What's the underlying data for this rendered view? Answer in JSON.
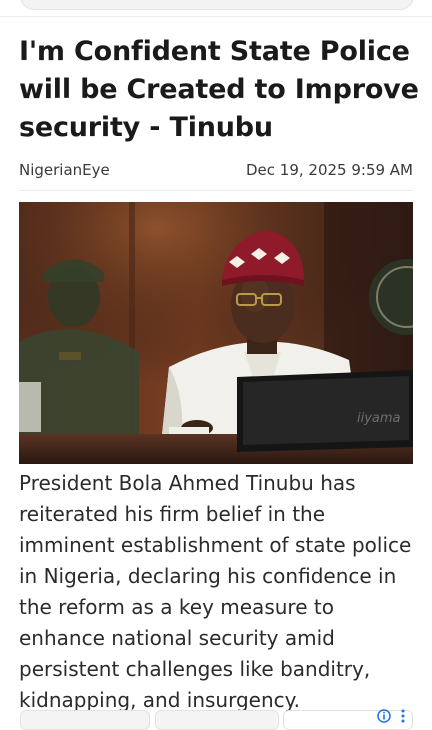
{
  "article": {
    "title": "I'm Confident State Police will be Created to Improve security - Tinubu",
    "source": "NigerianEye",
    "date": "Dec 19, 2025 9:59 AM",
    "image_alt": "President Bola Ahmed Tinubu seated at a meeting desk",
    "monitor_brand": "iiyama",
    "body": "President Bola Ahmed Tinubu has reiterated his firm belief in the imminent establishment of state police in Nigeria, declaring his confidence in the reform as a key measure to enhance national security amid persistent challenges like banditry, kidnapping, and insurgency."
  },
  "ad": {
    "info_icon": "info-icon",
    "menu_icon": "more-vert-icon"
  },
  "colors": {
    "accent_blue": "#1a73e8",
    "cap_red": "#8e1a2a"
  }
}
